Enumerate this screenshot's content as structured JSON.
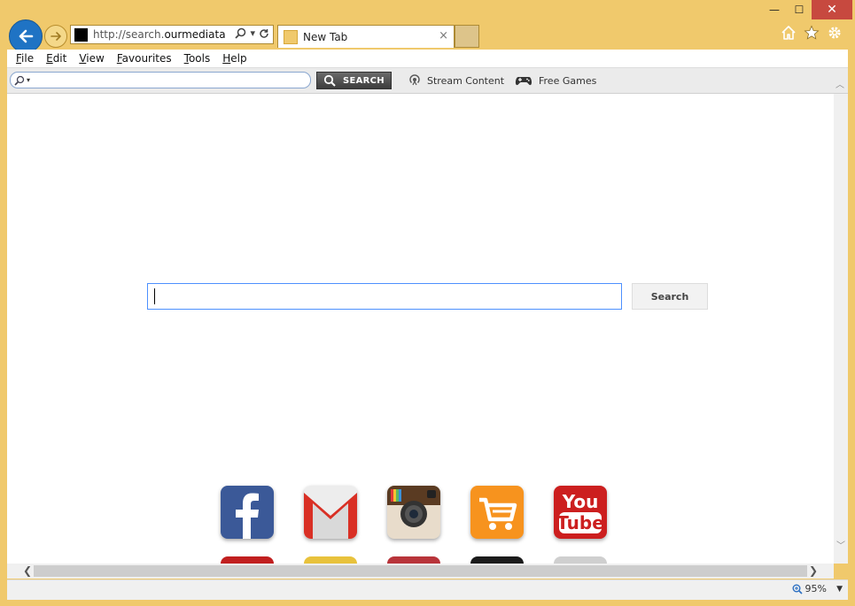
{
  "window": {
    "minimize": "—",
    "maximize": "☐",
    "close": "✕"
  },
  "address": {
    "prefix": "http://search.",
    "host": "ourmediatab..."
  },
  "tab": {
    "label": "New Tab",
    "close": "×"
  },
  "menu": {
    "items": [
      {
        "key": "F",
        "rest": "ile"
      },
      {
        "key": "E",
        "rest": "dit"
      },
      {
        "key": "V",
        "rest": "iew"
      },
      {
        "key": "F",
        "rest": "avourites"
      },
      {
        "key": "T",
        "rest": "ools"
      },
      {
        "key": "H",
        "rest": "elp"
      }
    ]
  },
  "toolbar": {
    "search_button": "SEARCH",
    "stream_label": "Stream Content",
    "games_label": "Free Games"
  },
  "main": {
    "search_button": "Search"
  },
  "tiles": [
    {
      "name": "facebook"
    },
    {
      "name": "gmail"
    },
    {
      "name": "instagram"
    },
    {
      "name": "shopping"
    },
    {
      "name": "youtube",
      "text_top": "You",
      "text_bottom": "Tube"
    }
  ],
  "status": {
    "zoom": "95%"
  },
  "colors": {
    "frame": "#f0c96c",
    "back_button": "#1f73c4",
    "close_button": "#c7493f",
    "focus_border": "#4d90fe"
  }
}
